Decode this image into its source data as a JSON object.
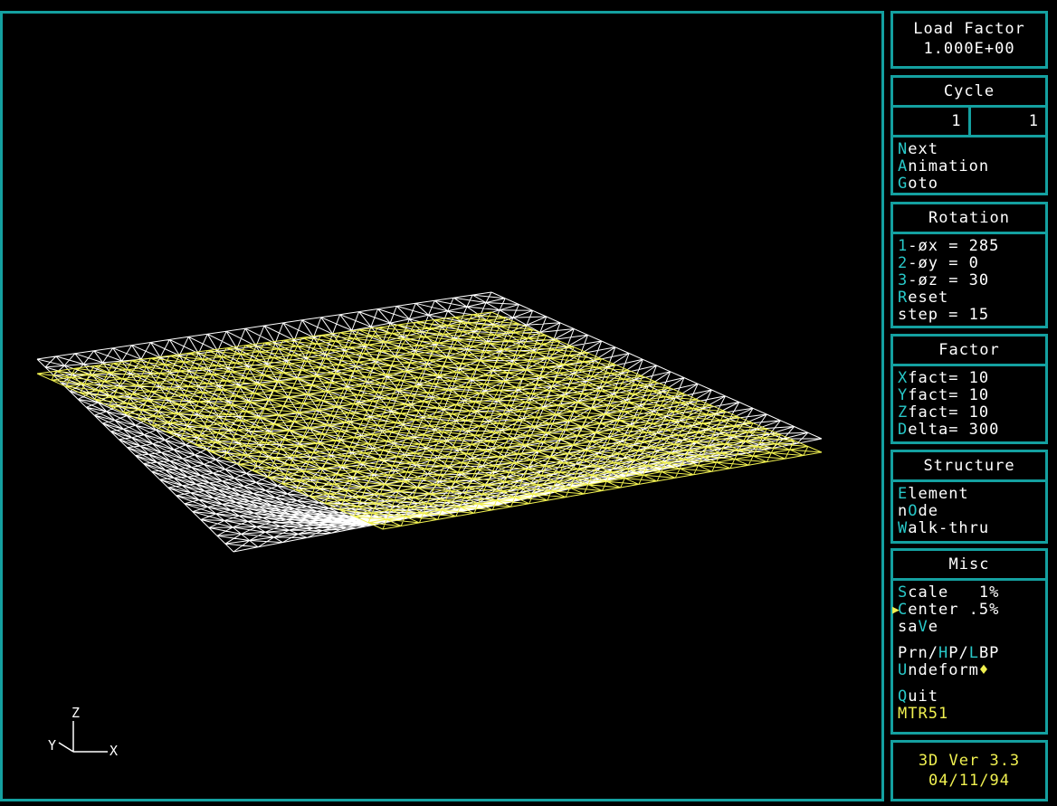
{
  "load_factor": {
    "title": "Load Factor",
    "value": "1.000E+00"
  },
  "cycle": {
    "title": "Cycle",
    "values": [
      "1",
      "1"
    ],
    "items": [
      {
        "key": "N",
        "rest": "ext"
      },
      {
        "key": "A",
        "rest": "nimation"
      },
      {
        "key": "G",
        "rest": "oto"
      }
    ]
  },
  "rotation": {
    "title": "Rotation",
    "items": [
      {
        "key": "1",
        "rest": "-øx = 285"
      },
      {
        "key": "2",
        "rest": "-øy = 0"
      },
      {
        "key": "3",
        "rest": "-øz = 30"
      },
      {
        "key": "R",
        "rest": "eset"
      },
      {
        "key": "",
        "rest": "step = 15"
      }
    ]
  },
  "factor": {
    "title": "Factor",
    "items": [
      {
        "key": "X",
        "rest": "fact= 10"
      },
      {
        "key": "Y",
        "rest": "fact= 10"
      },
      {
        "key": "Z",
        "rest": "fact= 10"
      },
      {
        "key": "D",
        "rest": "elta= 300"
      }
    ]
  },
  "structure": {
    "title": "Structure",
    "items": [
      {
        "pre": "",
        "key": "E",
        "rest": "lement"
      },
      {
        "pre": "n",
        "key": "O",
        "rest": "de"
      },
      {
        "pre": "",
        "key": "W",
        "rest": "alk-thru"
      }
    ]
  },
  "misc": {
    "title": "Misc",
    "scale": {
      "key": "S",
      "rest": "cale   1%"
    },
    "center": {
      "key": "C",
      "rest": "enter .5%"
    },
    "save": {
      "pre": "sa",
      "key": "V",
      "rest": "e"
    },
    "prn": {
      "a": "Prn/",
      "b": "H",
      "c": "P/",
      "d": "L",
      "e": "BP"
    },
    "undeform": {
      "key": "U",
      "rest": "ndeform",
      "mark": "♦"
    },
    "quit": {
      "key": "Q",
      "rest": "uit"
    },
    "file": "MTR51"
  },
  "version": {
    "line1": "3D Ver 3.3",
    "line2": "04/11/94"
  },
  "axis_labels": {
    "z": "Z",
    "y": "Y",
    "x": "X"
  },
  "colors": {
    "frame": "#14a0a0",
    "hotkey": "#28c8c8",
    "deformed": "#ffffff",
    "undeformed": "#f0f050"
  }
}
